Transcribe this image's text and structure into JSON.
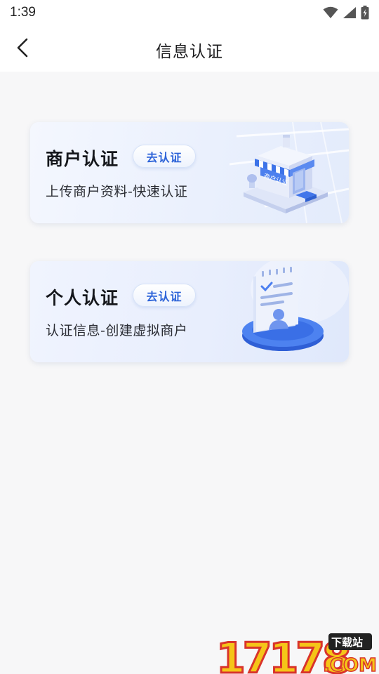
{
  "status_bar": {
    "time": "1:39"
  },
  "header": {
    "title": "信息认证"
  },
  "cards": [
    {
      "title": "商户认证",
      "button_label": "去认证",
      "subtitle": "上传商户资料-快速认证",
      "sign_text": "商户认证"
    },
    {
      "title": "个人认证",
      "button_label": "去认证",
      "subtitle": "认证信息-创建虚拟商户"
    }
  ],
  "watermark": {
    "number": "17178",
    "tag": "下载站",
    "domain": ".COM"
  },
  "colors": {
    "accent": "#2c63d8",
    "card_bg": "#eaf0fd",
    "page_bg": "#f7f7f8"
  }
}
